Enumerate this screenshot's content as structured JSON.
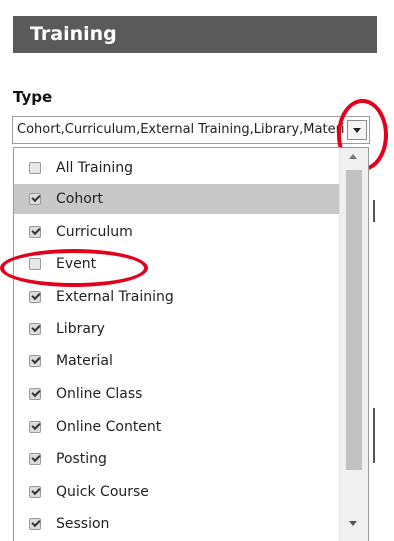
{
  "header": {
    "title": "Training"
  },
  "type_field": {
    "label": "Type",
    "selected_value": "Cohort,Curriculum,External Training,Library,Material,Online Class,Online Content,Posting,Quick Course,Session"
  },
  "dropdown": {
    "options": [
      {
        "label": "All Training",
        "checked": false
      },
      {
        "label": "Cohort",
        "checked": true
      },
      {
        "label": "Curriculum",
        "checked": true
      },
      {
        "label": "Event",
        "checked": false
      },
      {
        "label": "External Training",
        "checked": true
      },
      {
        "label": "Library",
        "checked": true
      },
      {
        "label": "Material",
        "checked": true
      },
      {
        "label": "Online Class",
        "checked": true
      },
      {
        "label": "Online Content",
        "checked": true
      },
      {
        "label": "Posting",
        "checked": true
      },
      {
        "label": "Quick Course",
        "checked": true
      },
      {
        "label": "Session",
        "checked": true
      }
    ],
    "highlighted_option": "Cohort"
  },
  "colors": {
    "header_bg": "#5a5a5a",
    "highlight_bg": "#c8c8c8",
    "annotation_red": "#e3001b"
  }
}
